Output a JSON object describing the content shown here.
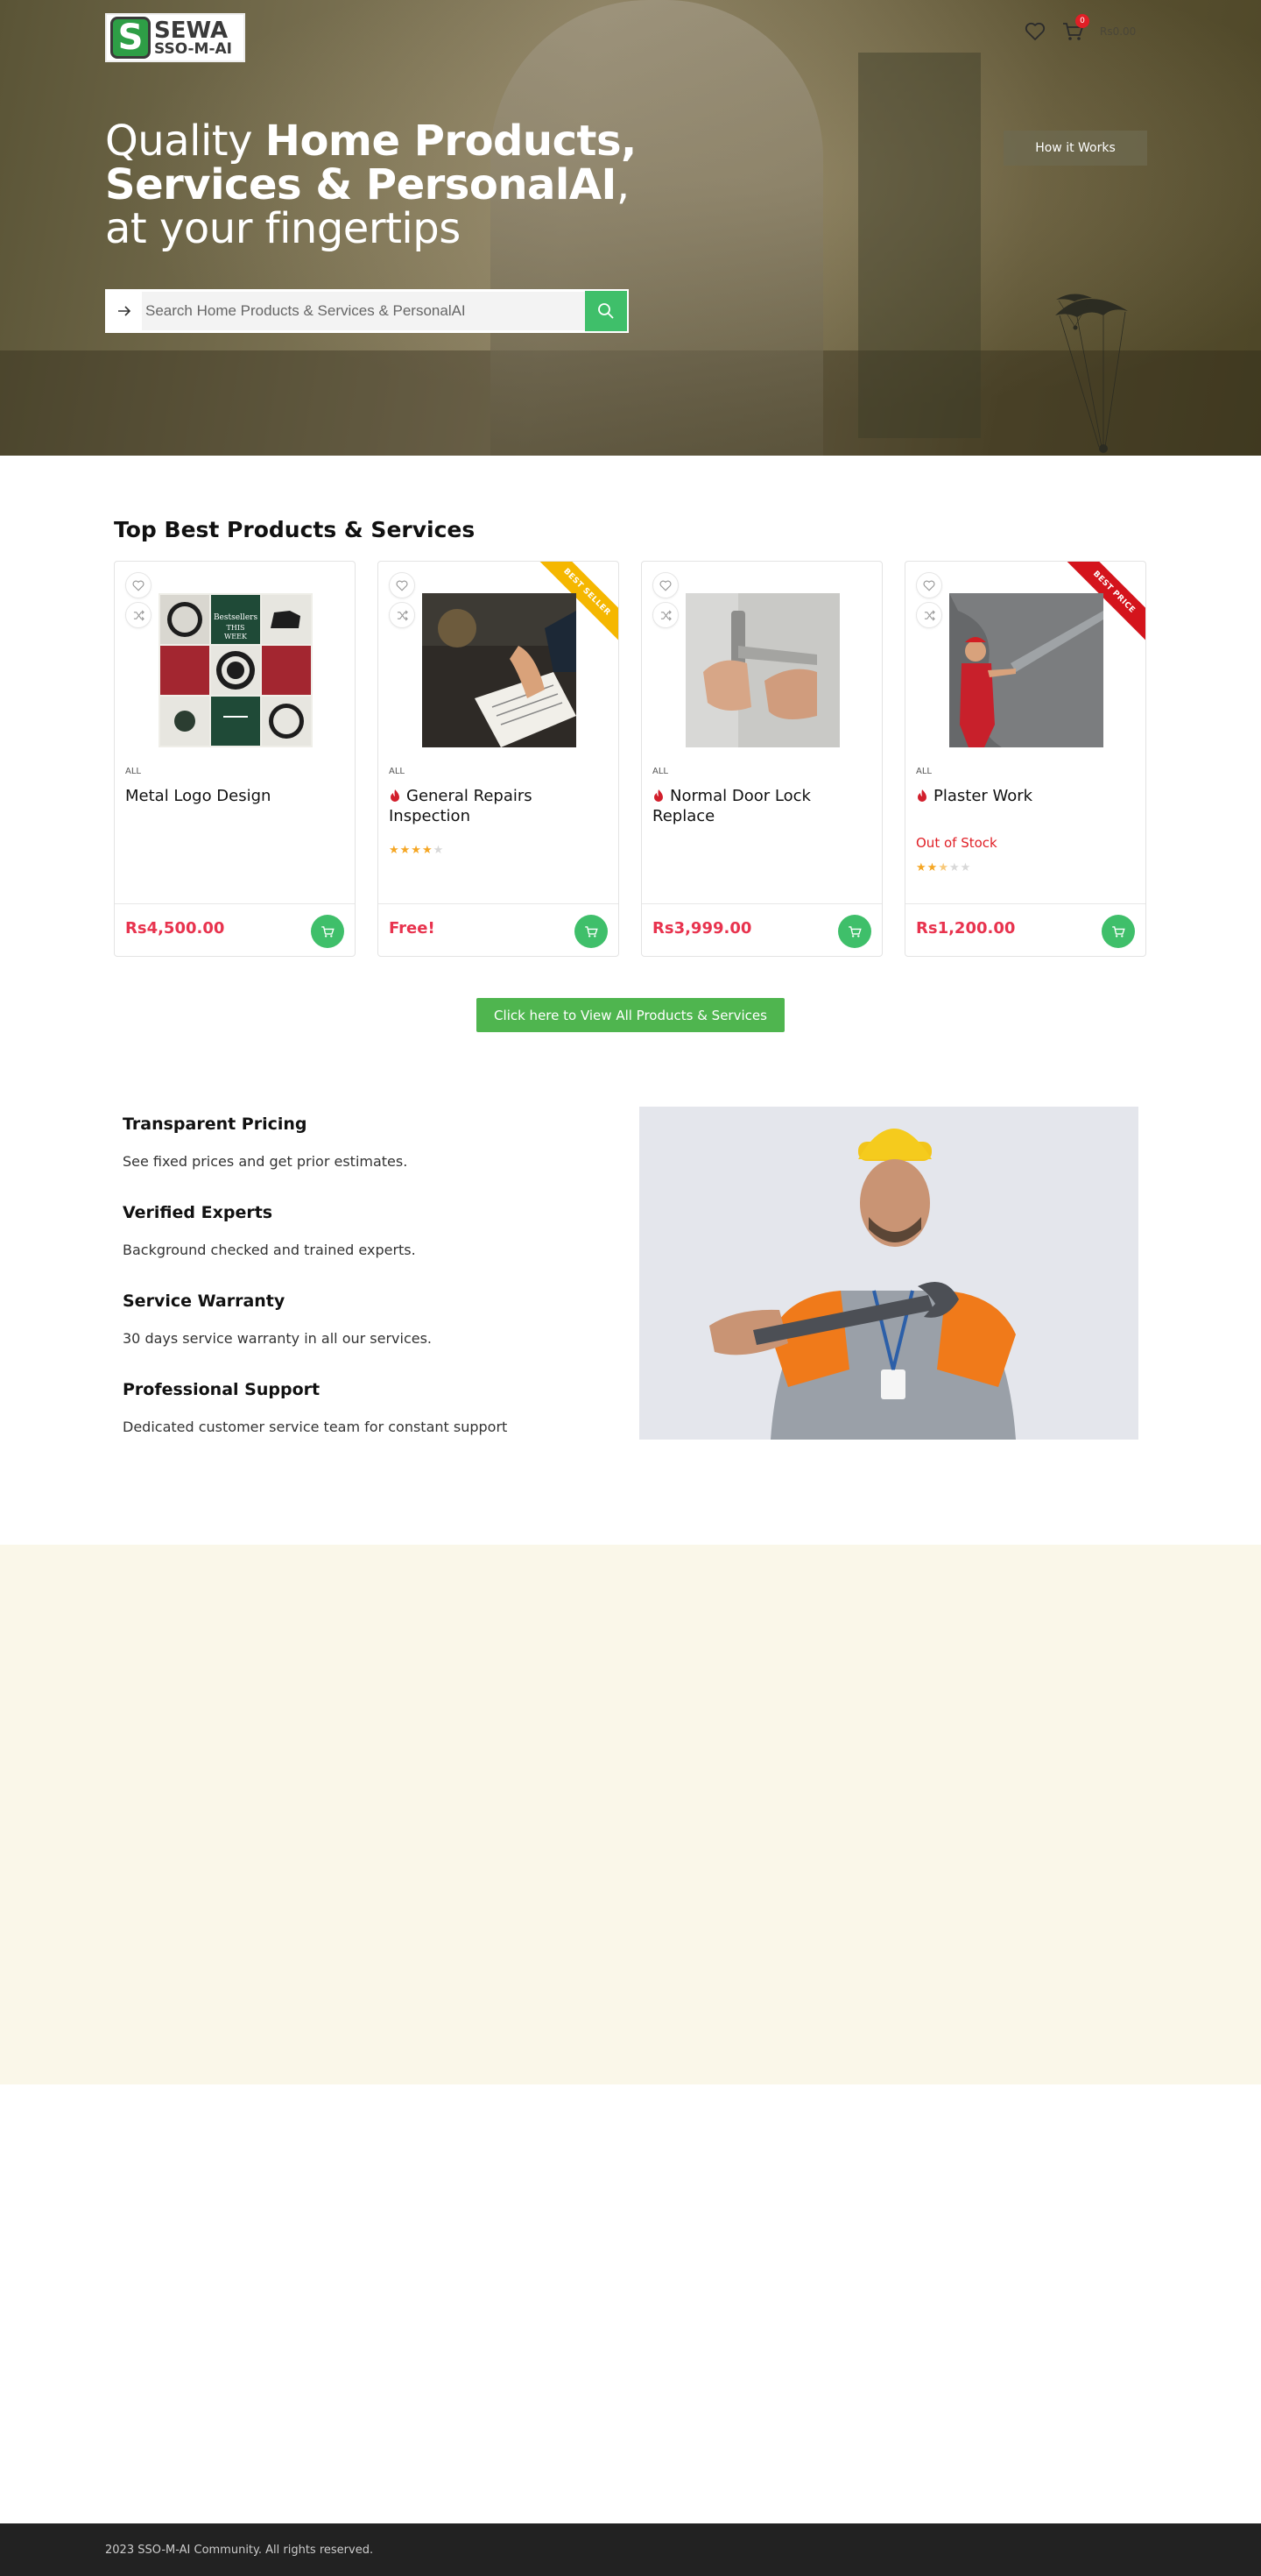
{
  "header": {
    "logo_line1": "SEWA",
    "logo_line2": "SSO-M-AI",
    "logo_mark": "S",
    "cart_count": "0",
    "cart_total": "Rs0.00",
    "wishlist_icon": "heart-icon",
    "cart_icon": "cart-icon"
  },
  "hero": {
    "line1_light": "Quality ",
    "line1_bold": "Home Products,",
    "line2_bold": "Services & PersonalAI",
    "line2_tail": ",",
    "line3_light": "at your fingertips",
    "how_it_works": "How it Works",
    "search_placeholder": "Search Home Products & Services & PersonalAI"
  },
  "products_section": {
    "title": "Top Best Products & Services",
    "items": [
      {
        "category": "ALL",
        "name": "Metal Logo Design",
        "price": "Rs4,500.00",
        "hot": false,
        "ribbon": "",
        "stock": "",
        "rating": null
      },
      {
        "category": "ALL",
        "name": "General Repairs Inspection",
        "price": "Free!",
        "hot": true,
        "ribbon": "BEST SELLER",
        "stock": "",
        "rating": 4
      },
      {
        "category": "ALL",
        "name": "Normal Door Lock Replace",
        "price": "Rs3,999.00",
        "hot": true,
        "ribbon": "",
        "stock": "",
        "rating": null
      },
      {
        "category": "ALL",
        "name": "Plaster Work",
        "price": "Rs1,200.00",
        "hot": true,
        "ribbon": "BEST PRICE",
        "stock": "Out of Stock",
        "rating": 2.5
      }
    ],
    "view_all": "Click here to View All Products & Services"
  },
  "features": [
    {
      "title": "Transparent Pricing",
      "text": "See fixed prices and get prior estimates."
    },
    {
      "title": "Verified Experts",
      "text": "Background checked and trained experts."
    },
    {
      "title": "Service Warranty",
      "text": "30 days service warranty in all our services."
    },
    {
      "title": "Professional Support",
      "text": "Dedicated customer service team for constant support"
    }
  ],
  "footer": {
    "copyright": "2023 SSO-M-AI Community. All rights reserved."
  },
  "colors": {
    "accent_green": "#3fbf6a",
    "price_red": "#e8334e",
    "cream_bg": "#faf7e9",
    "footer_bg": "#222222"
  }
}
